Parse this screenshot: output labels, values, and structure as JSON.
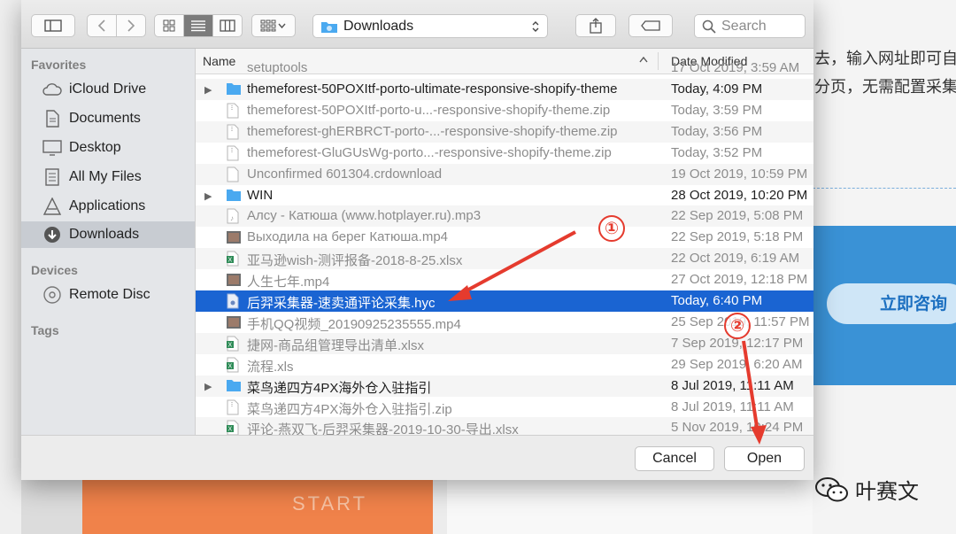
{
  "background": {
    "line1": "去，输入网址即可自",
    "line2": "分页，无需配置采集",
    "consult_button": "立即咨询",
    "start_text": "START"
  },
  "toolbar": {
    "sidebar_icon": "sidebar-toggle-icon",
    "back_icon": "chevron-left-icon",
    "forward_icon": "chevron-right-icon",
    "location": "Downloads",
    "search_placeholder": "Search"
  },
  "sidebar": {
    "favorites_label": "Favorites",
    "favorites": [
      {
        "label": "iCloud Drive",
        "icon": "cloud-icon"
      },
      {
        "label": "Documents",
        "icon": "document-icon"
      },
      {
        "label": "Desktop",
        "icon": "desktop-icon"
      },
      {
        "label": "All My Files",
        "icon": "all-files-icon"
      },
      {
        "label": "Applications",
        "icon": "applications-icon"
      },
      {
        "label": "Downloads",
        "icon": "downloads-icon",
        "selected": true
      }
    ],
    "devices_label": "Devices",
    "devices": [
      {
        "label": "Remote Disc",
        "icon": "disc-icon"
      }
    ],
    "tags_label": "Tags"
  },
  "file_list": {
    "columns": {
      "name": "Name",
      "date": "Date Modified"
    },
    "partial_top": {
      "name": "setuptools",
      "date": "17 Oct 2019, 3:59 AM"
    },
    "rows": [
      {
        "name": "themeforest-50POXItf-porto-ultimate-responsive-shopify-theme",
        "date": "Today, 4:09 PM",
        "type": "folder"
      },
      {
        "name": "themeforest-50POXItf-porto-u...-responsive-shopify-theme.zip",
        "date": "Today, 3:59 PM",
        "type": "zip"
      },
      {
        "name": "themeforest-ghERBRCT-porto-...-responsive-shopify-theme.zip",
        "date": "Today, 3:56 PM",
        "type": "zip"
      },
      {
        "name": "themeforest-GluGUsWg-porto...-responsive-shopify-theme.zip",
        "date": "Today, 3:52 PM",
        "type": "zip"
      },
      {
        "name": "Unconfirmed 601304.crdownload",
        "date": "19 Oct 2019, 10:59 PM",
        "type": "file"
      },
      {
        "name": "WIN",
        "date": "28 Oct 2019, 10:20 PM",
        "type": "folder"
      },
      {
        "name": "Алсу - Катюша (www.hotplayer.ru).mp3",
        "date": "22 Sep 2019, 5:08 PM",
        "type": "audio"
      },
      {
        "name": "Выходила на берег Катюша.mp4",
        "date": "22 Sep 2019, 5:18 PM",
        "type": "video"
      },
      {
        "name": "亚马逊wish-测评报备-2018-8-25.xlsx",
        "date": "22 Oct 2019, 6:19 AM",
        "type": "excel"
      },
      {
        "name": "人生七年.mp4",
        "date": "27 Oct 2019, 12:18 PM",
        "type": "video"
      },
      {
        "name": "后羿采集器-速卖通评论采集.hyc",
        "date": "Today, 6:40 PM",
        "type": "hyc",
        "selected": true
      },
      {
        "name": "手机QQ视频_20190925235555.mp4",
        "date": "25 Sep 2019, 11:57 PM",
        "type": "video"
      },
      {
        "name": "捷网-商品组管理导出清单.xlsx",
        "date": "7 Sep 2019, 12:17 PM",
        "type": "excel"
      },
      {
        "name": "流程.xls",
        "date": "29 Sep 2019, 6:20 AM",
        "type": "excel"
      },
      {
        "name": "菜鸟递四方4PX海外仓入驻指引",
        "date": "8 Jul 2019, 11:11 AM",
        "type": "folder"
      },
      {
        "name": "菜鸟递四方4PX海外仓入驻指引.zip",
        "date": "8 Jul 2019, 11:11 AM",
        "type": "zip"
      },
      {
        "name": "评论-燕双飞-后羿采集器-2019-10-30-导出.xlsx",
        "date": "5 Nov 2019, 10:24 PM",
        "type": "excel"
      }
    ]
  },
  "buttons": {
    "cancel": "Cancel",
    "open": "Open"
  },
  "annotations": {
    "marker1": "①",
    "marker2": "②",
    "color": "#e53b2e"
  },
  "watermark": {
    "text": "叶赛文"
  },
  "colors": {
    "selection": "#1a64d2",
    "folder": "#4aa9f0",
    "accent_blue": "#3a92d6"
  }
}
